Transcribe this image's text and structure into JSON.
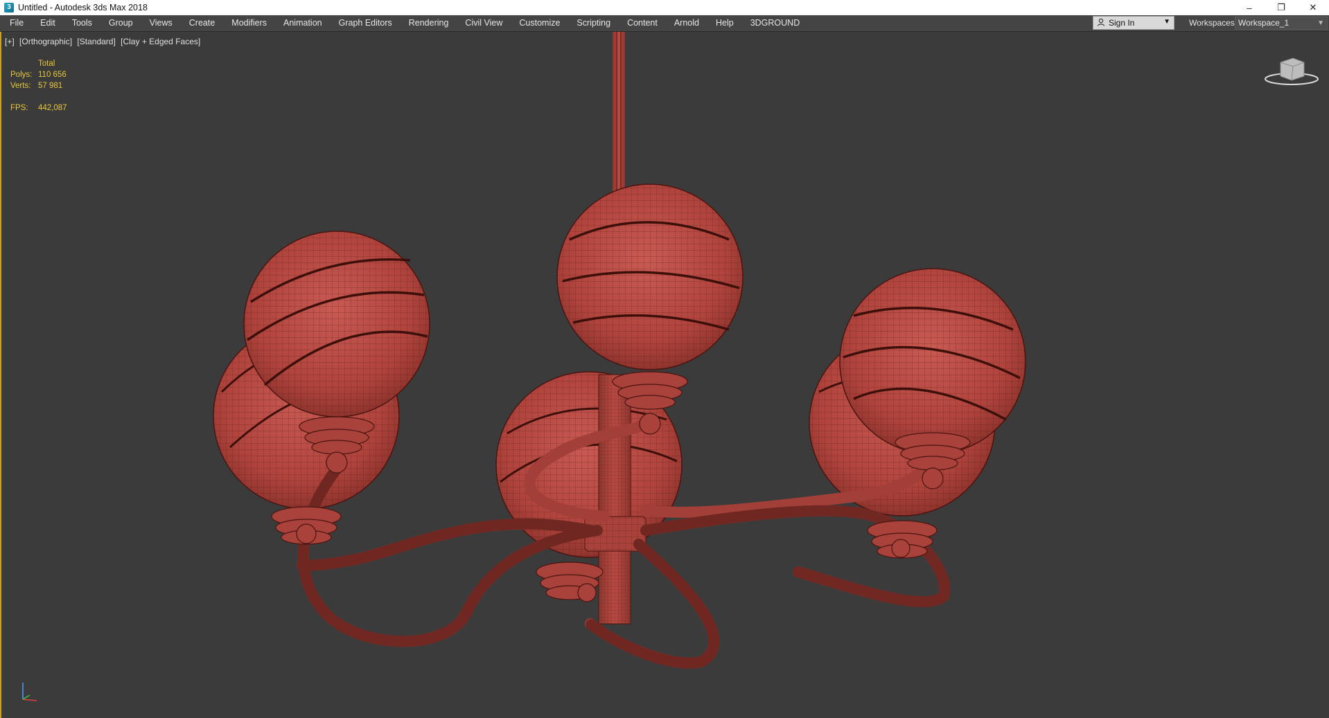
{
  "window": {
    "title": "Untitled - Autodesk 3ds Max 2018",
    "controls": {
      "minimize": "–",
      "restore": "❐",
      "close": "✕"
    }
  },
  "menu": {
    "items": [
      "File",
      "Edit",
      "Tools",
      "Group",
      "Views",
      "Create",
      "Modifiers",
      "Animation",
      "Graph Editors",
      "Rendering",
      "Civil View",
      "Customize",
      "Scripting",
      "Content",
      "Arnold",
      "Help",
      "3DGROUND"
    ],
    "signin_label": "Sign In",
    "workspaces_label": "Workspaces:",
    "workspace_value": "Workspace_1"
  },
  "viewport": {
    "labels": [
      "[+]",
      "[Orthographic]",
      "[Standard]",
      "[Clay + Edged Faces]"
    ],
    "stats": {
      "header": "Total",
      "polys_label": "Polys:",
      "polys_value": "110 656",
      "verts_label": "Verts:",
      "verts_value": "57 981",
      "fps_label": "FPS:",
      "fps_value": "442,087"
    }
  },
  "colors": {
    "model": "#b8463f",
    "viewport_bg": "#3b3b3b",
    "accent_border": "#c9a227",
    "stats_text": "#e7c93b"
  }
}
